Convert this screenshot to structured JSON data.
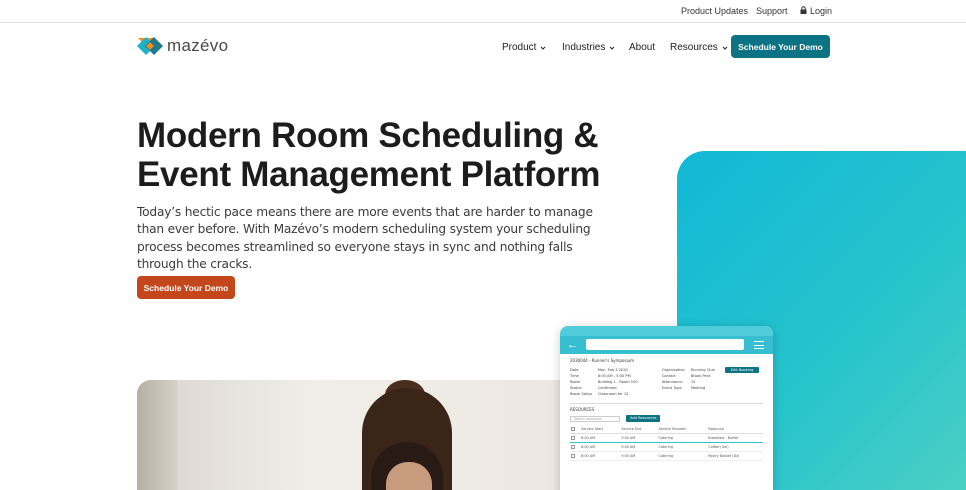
{
  "topbar": {
    "product_updates": "Product Updates",
    "support": "Support",
    "login": "Login"
  },
  "logo": {
    "text": "mazévo"
  },
  "nav": {
    "product": "Product",
    "industries": "Industries",
    "about": "About",
    "resources": "Resources",
    "cta": "Schedule Your Demo"
  },
  "hero": {
    "title": "Modern Room Scheduling & Event Management Platform",
    "subtitle": "Today’s hectic pace means there are more events that are harder to manage than ever before. With Mazévo’s modern scheduling system your scheduling process becomes streamlined so everyone stays in sync and nothing falls through the cracks.",
    "cta": "Schedule Your Demo"
  },
  "colors": {
    "teal_button": "#0c7384",
    "orange_button": "#c4471b",
    "teal_shape": "#11b8d6"
  },
  "mockup": {
    "event_title": "2030044 - Runner's Symposium",
    "labels_left": [
      "Date",
      "Time",
      "Room",
      "Status",
      "Room Setup"
    ],
    "values_left": [
      "Mon, Feb 3 2020",
      "8:00 AM - 5:00 PM",
      "Building 1 - Room 100",
      "Confirmed",
      "Classroom for 15"
    ],
    "labels_right": [
      "Organization",
      "Contact",
      "Attendance",
      "Event Type"
    ],
    "values_right": [
      "Running Club",
      "Brook Peck",
      "15",
      "Meeting"
    ],
    "edit_button": "Edit Booking",
    "resources_heading": "RESOURCES",
    "search_placeholder": "Search resources",
    "add_button": "Add Resources",
    "columns": [
      "",
      "Service Start",
      "Service End",
      "Service Provider",
      "Resource"
    ],
    "rows": [
      [
        "",
        "8:00 AM",
        "9:00 AM",
        "Catering",
        "Breakfast - Buffet"
      ],
      [
        "",
        "8:00 AM",
        "9:00 AM",
        "Catering",
        "Coffee (Gal)"
      ],
      [
        "",
        "8:00 AM",
        "9:00 AM",
        "Catering",
        "Pastry Basket (Dz)"
      ]
    ]
  }
}
